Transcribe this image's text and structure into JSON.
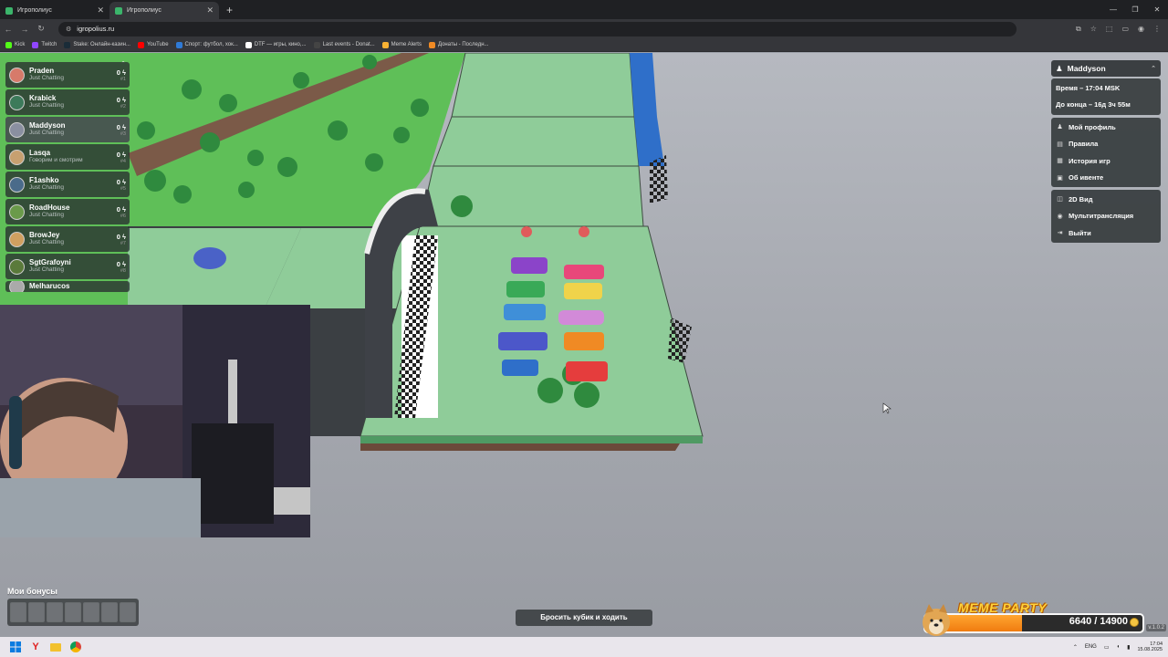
{
  "browser": {
    "tabs": [
      {
        "title": "Игрополиус",
        "active": false
      },
      {
        "title": "Игрополиус",
        "active": true
      }
    ],
    "url": "igropolius.ru",
    "bookmarks": [
      {
        "label": "Kick",
        "color": "#53fc18"
      },
      {
        "label": "Twitch",
        "color": "#9146ff"
      },
      {
        "label": "Stake: Онлайн-казин...",
        "color": "#1a2c38"
      },
      {
        "label": "YouTube",
        "color": "#ff0000"
      },
      {
        "label": "Спорт: футбол, хок...",
        "color": "#2f7ad6"
      },
      {
        "label": "DTF — игры, кино,...",
        "color": "#ffffff"
      },
      {
        "label": "Last events - Donat...",
        "color": "#444444"
      },
      {
        "label": "Meme Alerts",
        "color": "#f9b233"
      },
      {
        "label": "Донаты - Последн...",
        "color": "#f08a24"
      }
    ]
  },
  "leaderboard": {
    "players": [
      {
        "name": "Praden",
        "status": "Just Chatting",
        "score": "0",
        "rank": "#1"
      },
      {
        "name": "Krabick",
        "status": "Just Chatting",
        "score": "0",
        "rank": "#2"
      },
      {
        "name": "Maddyson",
        "status": "Just Chatting",
        "score": "0",
        "rank": "#3"
      },
      {
        "name": "Lasqa",
        "status": "Говорим и смотрим",
        "score": "0",
        "rank": "#4"
      },
      {
        "name": "F1ashko",
        "status": "Just Chatting",
        "score": "0",
        "rank": "#5"
      },
      {
        "name": "RoadHouse",
        "status": "Just Chatting",
        "score": "0",
        "rank": "#6"
      },
      {
        "name": "BrowJey",
        "status": "Just Chatting",
        "score": "0",
        "rank": "#7"
      },
      {
        "name": "SgtGrafoyni",
        "status": "Just Chatting",
        "score": "0",
        "rank": "#8"
      },
      {
        "name": "Melharucos",
        "status": "",
        "score": "",
        "rank": ""
      }
    ]
  },
  "menu": {
    "user": "Maddyson",
    "time": "Время – 17:04 MSK",
    "countdown": "До конца – 16д 3ч 55м",
    "items": [
      {
        "label": "Мой профиль",
        "icon": "user-icon"
      },
      {
        "label": "Правила",
        "icon": "book-icon"
      },
      {
        "label": "История игр",
        "icon": "history-icon"
      },
      {
        "label": "Об ивенте",
        "icon": "info-icon"
      }
    ],
    "items2": [
      {
        "label": "2D Вид",
        "icon": "map-icon"
      },
      {
        "label": "Мультитрансляция",
        "icon": "broadcast-icon"
      },
      {
        "label": "Выйти",
        "icon": "logout-icon"
      }
    ]
  },
  "bonuses": {
    "title": "Мои бонусы",
    "slots": 7
  },
  "action": {
    "label": "Бросить кубик и ходить"
  },
  "meme_party": {
    "title": "MEME PARTY",
    "value": "6640 / 14900",
    "progress": 0.4456
  },
  "version": "v.1.0.2",
  "taskbar": {
    "lang": "ENG",
    "time": "17:04",
    "date": "15.08.2025"
  },
  "colors": {
    "grass": "#5fbf58",
    "board": "#8fcc99",
    "panel": "#2d3234",
    "accent": "#f07c10"
  }
}
